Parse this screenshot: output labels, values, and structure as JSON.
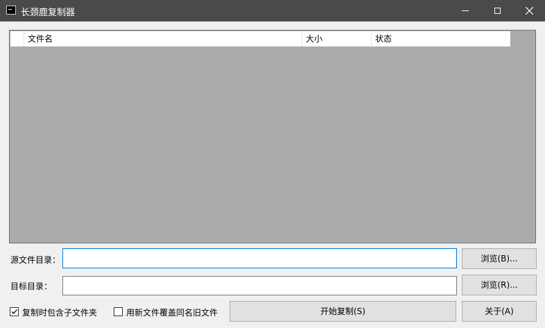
{
  "window": {
    "title": "长颈鹿复制器"
  },
  "list": {
    "columns": [
      "",
      "文件名",
      "大小",
      "状态"
    ]
  },
  "form": {
    "source_label": "源文件目录：",
    "target_label": "目标目录：",
    "source_value": "",
    "target_value": "",
    "browse_source": "浏览(B)...",
    "browse_target": "浏览(R)...",
    "include_subfolders": "复制时包含子文件夹",
    "include_subfolders_checked": true,
    "overwrite_older": "用新文件覆盖同名旧文件",
    "overwrite_older_checked": false,
    "start_copy": "开始复制(S)",
    "about": "关于(A)"
  }
}
